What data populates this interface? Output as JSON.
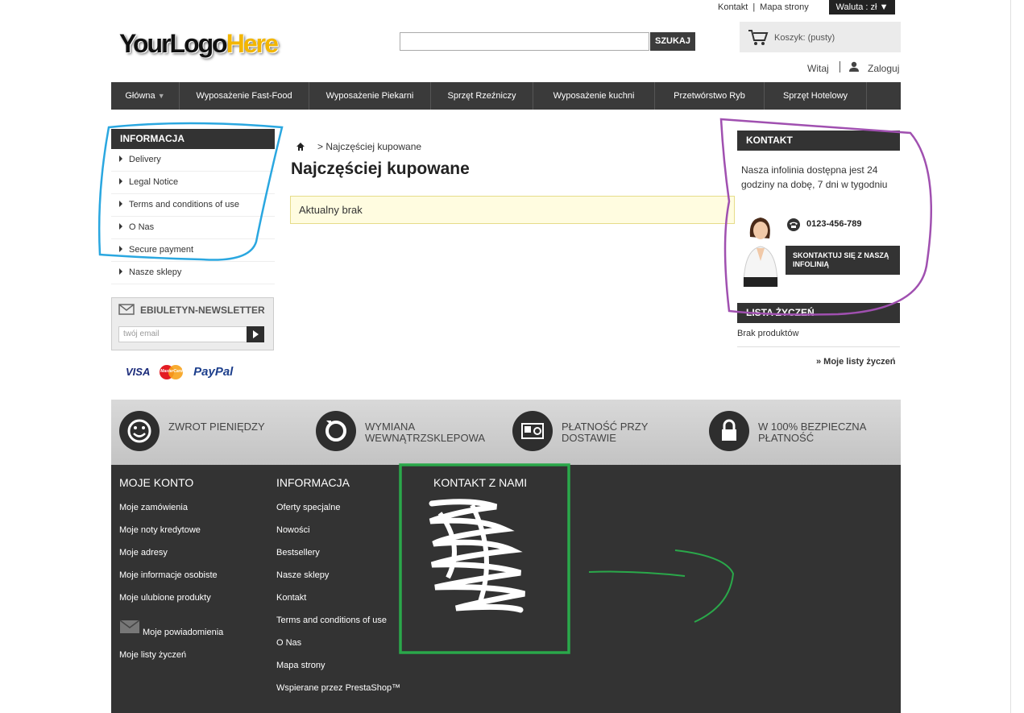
{
  "header": {
    "toplinks": [
      "Kontakt",
      "Mapa strony"
    ],
    "currency": "Waluta : zł",
    "logo_part1": "YourLogo",
    "logo_part2": "Here",
    "search_button": "SZUKAJ",
    "cart_label": "Koszyk: (pusty)",
    "welcome": "Witaj",
    "login": "Zaloguj"
  },
  "nav": {
    "items": [
      "Główna",
      "Wyposażenie Fast-Food",
      "Wyposażenie Piekarni",
      "Sprzęt Rzeźniczy",
      "Wyposażenie kuchni",
      "Przetwórstwo Ryb",
      "Sprzęt Hotelowy"
    ]
  },
  "left": {
    "info_title": "INFORMACJA",
    "info_items": [
      "Delivery",
      "Legal Notice",
      "Terms and conditions of use",
      "O Nas",
      "Secure payment",
      "Nasze sklepy"
    ],
    "newsletter_title": "EBIULETYN-NEWSLETTER",
    "newsletter_placeholder": "twój email",
    "payments": [
      "VISA",
      "MasterCard",
      "PayPal"
    ]
  },
  "main": {
    "breadcrumb": "Najczęściej kupowane",
    "title": "Najczęściej kupowane",
    "alert": "Aktualny brak"
  },
  "right": {
    "kontakt_title": "KONTAKT",
    "kontakt_text": "Nasza infolinia dostępna jest 24 godziny na dobę, 7 dni w tygodniu",
    "phone": "0123-456-789",
    "contact_button": "SKONTAKTUJ SIĘ Z NASZĄ INFOLINIĄ",
    "wishlist_title": "LISTA ŻYCZEŃ",
    "wishlist_empty": "Brak produktów",
    "wishlist_link": "» Moje listy życzeń"
  },
  "reassurance": [
    "ZWROT PIENIĘDZY",
    "WYMIANA WEWNĄTRZSKLEPOWA",
    "PŁATNOŚĆ PRZY DOSTAWIE",
    "W 100% BEZPIECZNA PŁATNOŚĆ"
  ],
  "footer": {
    "account_title": "MOJE KONTO",
    "account_items": [
      "Moje zamówienia",
      "Moje noty kredytowe",
      "Moje adresy",
      "Moje informacje osobiste",
      "Moje ulubione produkty",
      "Moje powiadomienia",
      "Moje listy życzeń"
    ],
    "info_title": "INFORMACJA",
    "info_items": [
      "Oferty specjalne",
      "Nowości",
      "Bestsellery",
      "Nasze sklepy",
      "Kontakt",
      "Terms and conditions of use",
      "O Nas",
      "Mapa strony",
      "Wspierane przez PrestaShop™"
    ],
    "contact_title": "KONTAKT Z NAMI"
  },
  "colors": {
    "annotation_blue": "#2aa7e0",
    "annotation_purple": "#a050b0",
    "annotation_green": "#2aa84a",
    "dark": "#333333"
  }
}
